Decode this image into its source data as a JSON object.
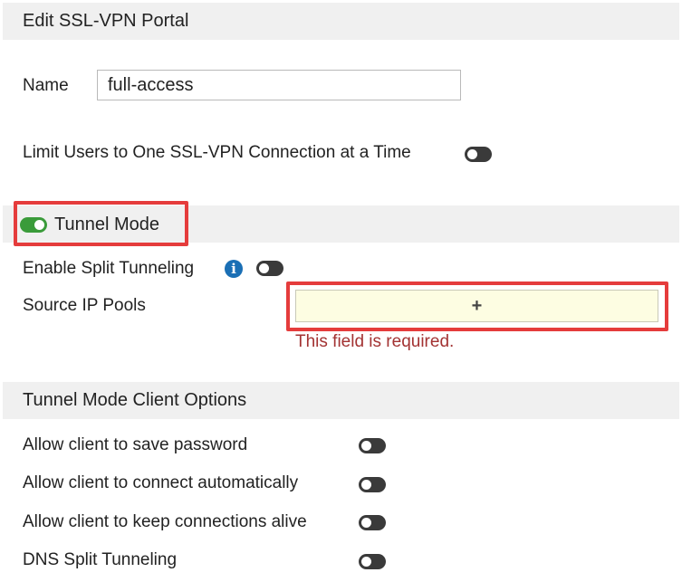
{
  "dialog": {
    "title": "Edit SSL-VPN Portal"
  },
  "name_field": {
    "label": "Name",
    "value": "full-access"
  },
  "limit_users": {
    "label": "Limit Users to One SSL-VPN Connection at a Time",
    "enabled": false
  },
  "tunnel_mode": {
    "label": "Tunnel Mode",
    "enabled": true
  },
  "split_tunneling": {
    "label": "Enable Split Tunneling",
    "info_icon": "info-icon",
    "enabled": false
  },
  "source_ip_pools": {
    "label": "Source IP Pools",
    "add_symbol": "+",
    "error": "This field is required."
  },
  "client_options": {
    "title": "Tunnel Mode Client Options",
    "items": [
      {
        "label": "Allow client to save password",
        "enabled": false
      },
      {
        "label": "Allow client to connect automatically",
        "enabled": false
      },
      {
        "label": "Allow client to keep connections alive",
        "enabled": false
      },
      {
        "label": "DNS Split Tunneling",
        "enabled": false
      }
    ]
  },
  "colors": {
    "highlight": "#e53c3c",
    "toggle_on": "#3a9b3a",
    "toggle_off": "#3a3a3a",
    "error": "#a33333",
    "info": "#1a6fb5",
    "required_field_bg": "#fdfde2"
  }
}
